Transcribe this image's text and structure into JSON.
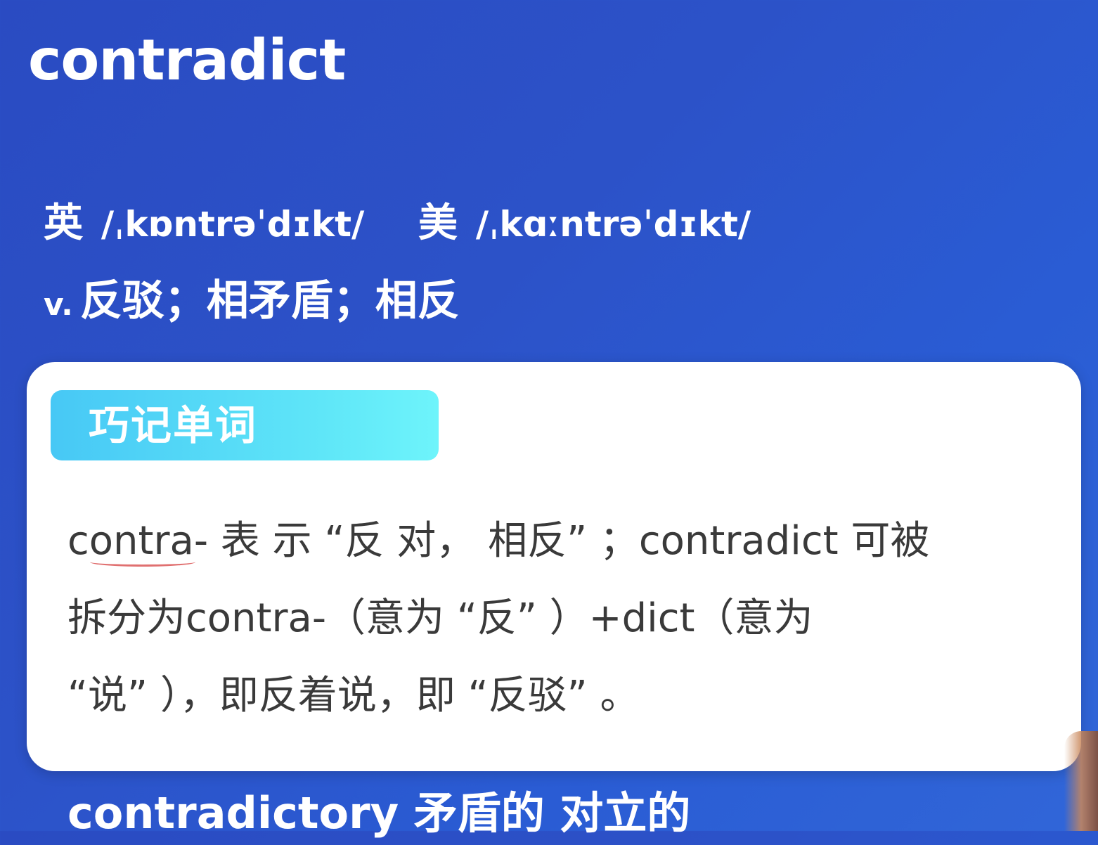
{
  "word": "contradict",
  "phonetics": {
    "uk": {
      "label": "英",
      "ipa": "/ˌkɒntrəˈdɪkt/"
    },
    "us": {
      "label": "美",
      "ipa": "/ˌkɑːntrəˈdɪkt/"
    }
  },
  "definition": {
    "pos": "v.",
    "meaning": "反驳；相矛盾；相反"
  },
  "memo_card": {
    "tag": "巧记单词",
    "lines": [
      "contra- 表 示 “反 对， 相反” ；contradict 可被",
      "拆分为contra-（意为 “反” ）+dict（意为",
      " “说” ），即反着说，即 “反驳” 。"
    ]
  },
  "related": {
    "text": "contradictory  矛盾的  对立的"
  }
}
